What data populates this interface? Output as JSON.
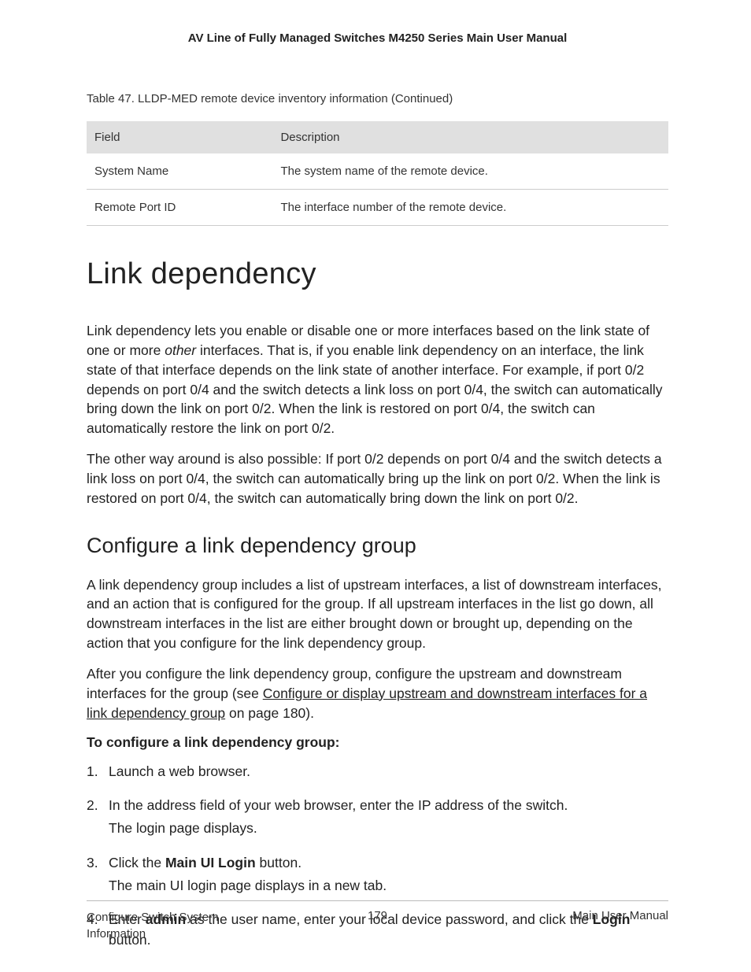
{
  "header": {
    "doc_title": "AV Line of Fully Managed Switches M4250 Series Main User Manual"
  },
  "table": {
    "caption": "Table 47. LLDP-MED remote device inventory information (Continued)",
    "headers": {
      "c0": "Field",
      "c1": "Description"
    },
    "rows": [
      {
        "field": "System Name",
        "desc": "The system name of the remote device."
      },
      {
        "field": "Remote Port ID",
        "desc": "The interface number of the remote device."
      }
    ]
  },
  "section": {
    "h1": "Link dependency",
    "p1_a": "Link dependency lets you enable or disable one or more interfaces based on the link state of one or more ",
    "p1_i": "other",
    "p1_b": " interfaces. That is, if you enable link dependency on an interface, the link state of that interface depends on the link state of another interface. For example, if port 0/2 depends on port 0/4 and the switch detects a link loss on port 0/4, the switch can automatically bring down the link on port 0/2. When the link is restored on port 0/4, the switch can automatically restore the link on port 0/2.",
    "p2": "The other way around is also possible: If port 0/2 depends on port 0/4 and the switch detects a link loss on port 0/4, the switch can automatically bring up the link on port 0/2. When the link is restored on port 0/4, the switch can automatically bring down the link on port 0/2.",
    "h2": "Configure a link dependency group",
    "p3": "A link dependency group includes a list of upstream interfaces, a list of downstream interfaces, and an action that is configured for the group. If all upstream interfaces in the list go down, all downstream interfaces in the list are either brought down or brought up, depending on the action that you configure for the link dependency group.",
    "p4_a": "After you configure the link dependency group, configure the upstream and downstream interfaces for the group (see ",
    "p4_link": "Configure or display upstream and downstream interfaces for a link dependency group",
    "p4_b": " on page 180).",
    "proc_heading": "To configure a link dependency group:",
    "steps": {
      "s1": "Launch a web browser.",
      "s2a": "In the address field of your web browser, enter the IP address of the switch.",
      "s2b": "The login page displays.",
      "s3a_pre": "Click the ",
      "s3a_bold": "Main UI Login",
      "s3a_post": " button.",
      "s3b": "The main UI login page displays in a new tab.",
      "s4_pre": "Enter ",
      "s4_bold1": "admin",
      "s4_mid": " as the user name, enter your local device password, and click the ",
      "s4_bold2": "Login",
      "s4_post": " button."
    }
  },
  "footer": {
    "left": "Configure Switch System Information",
    "center": "179",
    "right": "Main User Manual"
  }
}
